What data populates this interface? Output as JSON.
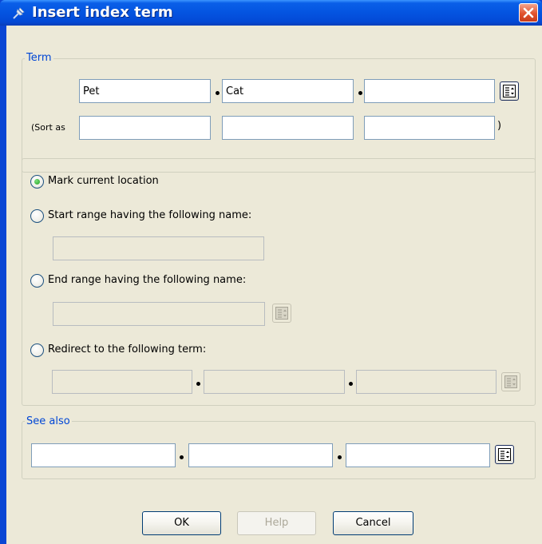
{
  "window": {
    "title": "Insert index term"
  },
  "term": {
    "legend": "Term",
    "values": [
      "Pet",
      "Cat",
      ""
    ],
    "sort_as_label": "(Sort as",
    "sort_as_values": [
      "",
      "",
      ""
    ],
    "close_paren": ")"
  },
  "location": {
    "mark_current": "Mark current location",
    "start_range": "Start range having the following name:",
    "start_range_value": "",
    "end_range": "End range having the following name:",
    "end_range_value": "",
    "redirect": "Redirect to the following term:",
    "redirect_values": [
      "",
      "",
      ""
    ],
    "selected": "mark_current"
  },
  "see_also": {
    "legend": "See also",
    "values": [
      "",
      "",
      ""
    ]
  },
  "buttons": {
    "ok": "OK",
    "help": "Help",
    "cancel": "Cancel"
  },
  "colors": {
    "title_bar": "#0454e0",
    "dialog_bg": "#ece9d8",
    "legend_text": "#0046d5",
    "close_button": "#e1522e"
  },
  "icons": {
    "title": "pin-icon",
    "close": "close-icon",
    "term_picker": "term-picker-icon"
  }
}
